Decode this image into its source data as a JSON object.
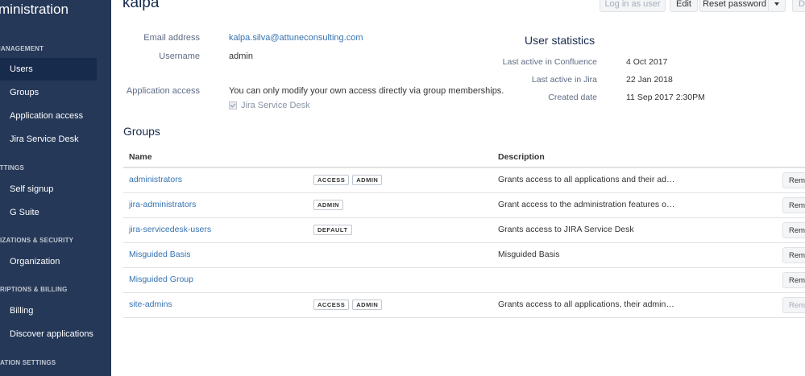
{
  "sidebar": {
    "title": "ministration",
    "sections": [
      {
        "label": "MANAGEMENT"
      },
      {
        "label": "ETTINGS"
      },
      {
        "label": "NIZATIONS & SECURITY"
      },
      {
        "label": "CRIPTIONS & BILLING"
      },
      {
        "label": "CATION SETTINGS"
      }
    ],
    "items": [
      {
        "label": "Users",
        "active": true
      },
      {
        "label": "Groups"
      },
      {
        "label": "Application access"
      },
      {
        "label": "Jira Service Desk"
      },
      {
        "label": "Self signup"
      },
      {
        "label": "G Suite"
      },
      {
        "label": "Organization"
      },
      {
        "label": "Billing"
      },
      {
        "label": "Discover applications"
      }
    ]
  },
  "header": {
    "title": "kalpa",
    "buttons": {
      "login_as_user": "Log in as user",
      "edit": "Edit",
      "reset_password": "Reset password",
      "delete": "D"
    }
  },
  "details": {
    "email_label": "Email address",
    "email_value": "kalpa.silva@attuneconsulting.com",
    "username_label": "Username",
    "username_value": "admin",
    "app_access_label": "Application access",
    "app_access_text": "You can only modify your own access directly via group memberships.",
    "app_access_checkbox": "Jira Service Desk"
  },
  "stats": {
    "title": "User statistics",
    "rows": [
      {
        "label": "Last active in Confluence",
        "value": "4 Oct 2017"
      },
      {
        "label": "Last active in Jira",
        "value": "22 Jan 2018"
      },
      {
        "label": "Created date",
        "value": "11 Sep 2017 2:30PM"
      }
    ]
  },
  "groups": {
    "title": "Groups",
    "col_name": "Name",
    "col_description": "Description",
    "remove_label": "Remove",
    "rows": [
      {
        "name": "administrators",
        "badges": [
          "ACCESS",
          "ADMIN"
        ],
        "description": "Grants access to all applications and their ad…",
        "remove_disabled": false
      },
      {
        "name": "jira-administrators",
        "badges": [
          "ADMIN"
        ],
        "description": "Grant access to the administration features o…",
        "remove_disabled": false
      },
      {
        "name": "jira-servicedesk-users",
        "badges": [
          "DEFAULT"
        ],
        "description": "Grants access to JIRA Service Desk",
        "remove_disabled": false
      },
      {
        "name": "Misguided Basis",
        "badges": [],
        "description": "Misguided Basis",
        "remove_disabled": false
      },
      {
        "name": "Misguided Group",
        "badges": [],
        "description": "",
        "remove_disabled": false
      },
      {
        "name": "site-admins",
        "badges": [
          "ACCESS",
          "ADMIN"
        ],
        "description": "Grants access to all applications, their admin…",
        "remove_disabled": true
      }
    ]
  }
}
